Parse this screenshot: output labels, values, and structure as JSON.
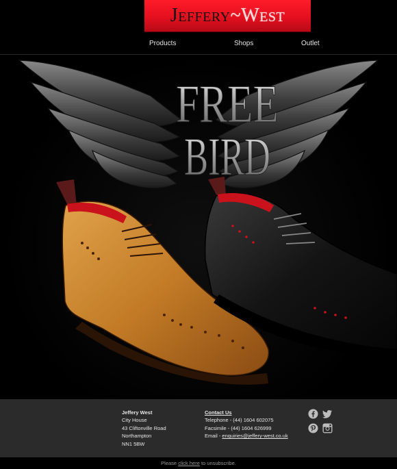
{
  "brand": {
    "logo_left": "Jeffery",
    "logo_sep": "~",
    "logo_right": "West"
  },
  "nav": {
    "products": "Products",
    "shops": "Shops",
    "outlet": "Outlet"
  },
  "hero": {
    "line1": "FREE",
    "line2": "BIRD"
  },
  "footer": {
    "address": {
      "title": "Jeffery West",
      "line1": "City House",
      "line2": "43 Cliftonville Road",
      "line3": "Northampton",
      "line4": "NN1 5BW"
    },
    "contact": {
      "title": "Contact Us",
      "telephone": "Telephone - (44) 1604 602075",
      "facsimile": "Facsimile - (44) 1604 626999",
      "email_prefix": "Email - ",
      "email": "enquiries@jeffery-west.co.uk"
    },
    "social": [
      "facebook-icon",
      "twitter-icon",
      "pinterest-icon",
      "instagram-icon"
    ]
  },
  "unsubscribe": {
    "prefix": "Please ",
    "link": "click here",
    "suffix": " to unsubscribe."
  },
  "colors": {
    "brand_red": "#e4101f",
    "background": "#000000",
    "footer_bg": "#2b2b2b"
  }
}
